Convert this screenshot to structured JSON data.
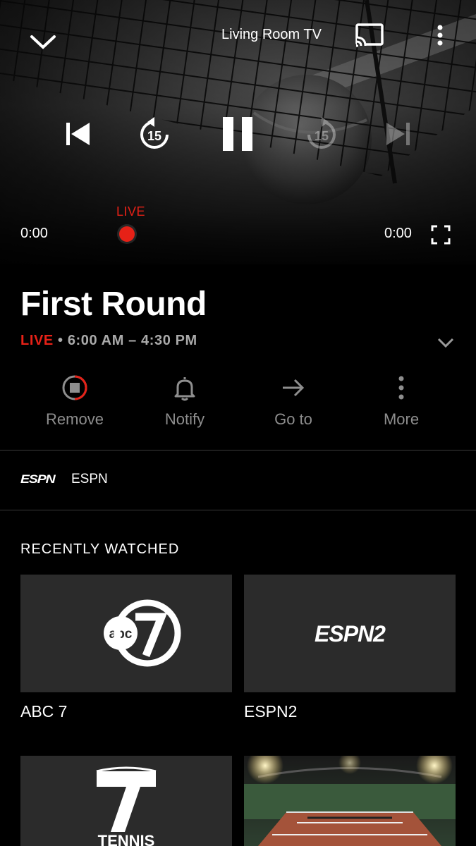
{
  "player": {
    "cast_device": "Living Room TV",
    "live_label": "LIVE",
    "current_time": "0:00",
    "end_time": "0:00",
    "skip_seconds": "15"
  },
  "program": {
    "title": "First Round",
    "live_label": "LIVE",
    "separator": "•",
    "time_range": "6:00 AM – 4:30 PM"
  },
  "actions": [
    {
      "label": "Remove",
      "icon": "stop-record-icon"
    },
    {
      "label": "Notify",
      "icon": "bell-icon"
    },
    {
      "label": "Go to",
      "icon": "arrow-right-icon"
    },
    {
      "label": "More",
      "icon": "more-vert-icon"
    }
  ],
  "channel": {
    "logo_text": "ESPN",
    "name": "ESPN"
  },
  "recently_watched": {
    "heading": "RECENTLY WATCHED",
    "items": [
      {
        "label": "ABC 7",
        "logo": "abc 7"
      },
      {
        "label": "ESPN2",
        "logo": "ESPN2"
      },
      {
        "label": "",
        "logo": "TENNIS"
      },
      {
        "label": "",
        "logo": ""
      }
    ]
  },
  "colors": {
    "accent_live": "#e62117",
    "background": "#000000",
    "tile": "#2b2b2b"
  }
}
